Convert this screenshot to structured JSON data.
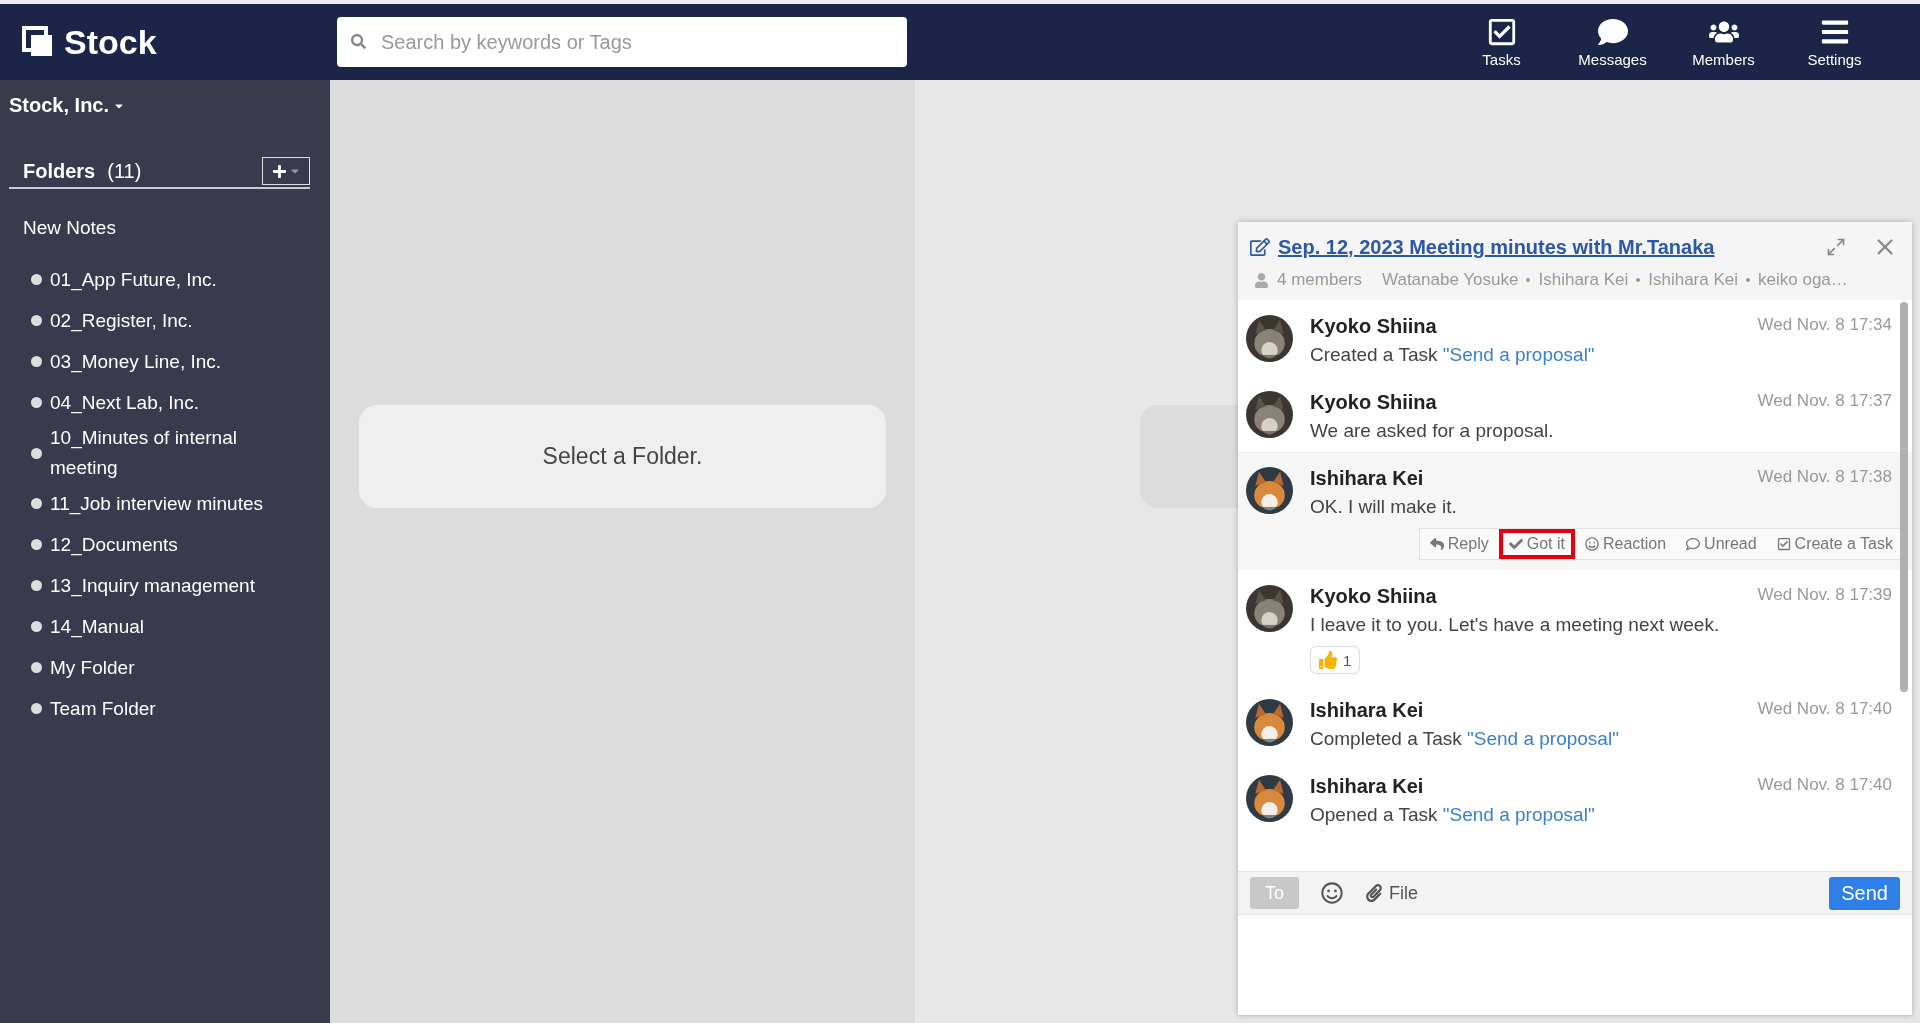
{
  "header": {
    "logo": "Stock",
    "search": {
      "placeholder": "Search by keywords or Tags"
    },
    "nav": [
      {
        "label": "Tasks"
      },
      {
        "label": "Messages"
      },
      {
        "label": "Members"
      },
      {
        "label": "Settings"
      }
    ]
  },
  "sidebar": {
    "team": "Stock, Inc.",
    "folders_title": "Folders",
    "folders_count": "(11)",
    "new_notes": "New Notes",
    "folders": [
      "01_App Future, Inc.",
      "02_Register, Inc.",
      "03_Money Line, Inc.",
      "04_Next Lab, Inc.",
      "10_Minutes of internal meeting",
      "11_Job interview minutes",
      "12_Documents",
      "13_Inquiry management",
      "14_Manual",
      "My Folder",
      "Team Folder"
    ]
  },
  "main": {
    "message": "Select a Folder."
  },
  "chat": {
    "title": "Sep. 12, 2023 Meeting minutes with Mr.Tanaka",
    "members_count": "4 members",
    "members": [
      "Watanabe Yosuke",
      "Ishihara Kei",
      "Ishihara Kei",
      "keiko oga…"
    ],
    "messages": [
      {
        "author": "Kyoko Shiina",
        "time": "Wed Nov. 8 17:34",
        "text": "Created a Task ",
        "link": "\"Send a proposal\"",
        "hovered": false
      },
      {
        "author": "Kyoko Shiina",
        "time": "Wed Nov. 8 17:37",
        "text": "We are asked for a proposal.",
        "hovered": false
      },
      {
        "author": "Ishihara Kei",
        "time": "Wed Nov. 8 17:38",
        "text": "OK. I will make it.",
        "hovered": true
      },
      {
        "author": "Kyoko Shiina",
        "time": "Wed Nov. 8 17:39",
        "text": "I leave it to you. Let's have a meeting next week.",
        "hovered": false,
        "reactions": [
          {
            "kind": "thumbs-up",
            "count": "1"
          }
        ]
      },
      {
        "author": "Ishihara Kei",
        "time": "Wed Nov. 8 17:40",
        "text": "Completed a Task ",
        "link": "\"Send a proposal\"",
        "hovered": false
      },
      {
        "author": "Ishihara Kei",
        "time": "Wed Nov. 8 17:40",
        "text": "Opened a Task ",
        "link": "\"Send a proposal\"",
        "hovered": false
      }
    ],
    "actions": [
      {
        "label": "Reply",
        "highlighted": false
      },
      {
        "label": "Got it",
        "highlighted": true
      },
      {
        "label": "Reaction",
        "highlighted": false
      },
      {
        "label": "Unread",
        "highlighted": false
      },
      {
        "label": "Create a Task",
        "highlighted": false
      }
    ],
    "composer": {
      "to": "To",
      "file": "File",
      "send": "Send"
    }
  }
}
